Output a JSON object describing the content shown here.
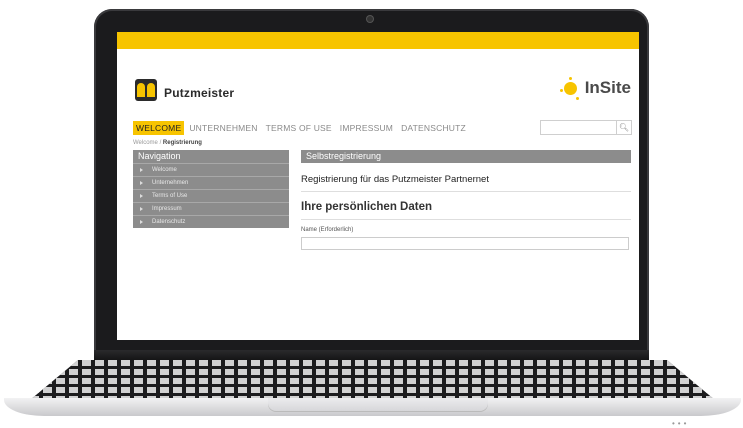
{
  "brand": {
    "name": "Putzmeister",
    "insite": "InSite",
    "accent": "#f7c400"
  },
  "topnav": {
    "items": [
      "WELCOME",
      "UNTERNEHMEN",
      "TERMS OF USE",
      "IMPRESSUM",
      "DATENSCHUTZ"
    ],
    "active": "WELCOME"
  },
  "search": {
    "icon": "search-icon"
  },
  "breadcrumb": {
    "home": "Welcome",
    "separator": "/",
    "current": "Registrierung"
  },
  "sidenav": {
    "title": "Navigation",
    "items": [
      "Welcome",
      "Unternehmen",
      "Terms of Use",
      "Impressum",
      "Datenschutz"
    ]
  },
  "content": {
    "bar_title": "Selbstregistrierung",
    "heading": "Registrierung für das Putzmeister Partnernet",
    "section": "Ihre persönlichen Daten",
    "name_label": "Name (Erforderlich)",
    "name_value": ""
  }
}
